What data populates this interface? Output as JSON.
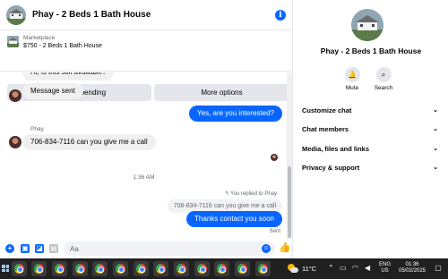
{
  "header": {
    "title": "Phay - 2 Beds 1 Bath House"
  },
  "marketplace": {
    "label": "Marketplace",
    "listing": "$750 - 2 Beds 1 Bath House",
    "pending_button": "Mark as pending",
    "more_button": "More options"
  },
  "messages": {
    "partial_top": "Hi, is this still available?",
    "msg1": "Message sent",
    "out1": "Yes, are you interested?",
    "sender": "Phay",
    "msg2": "706-834-7116 can you give me a call",
    "timestamp": "1:36 AM",
    "reply_note": "You replied to Phay",
    "quoted": "706-834-7116 can you give me a call",
    "out2": "Thanks contact you soon",
    "status": "Sent"
  },
  "composer": {
    "placeholder": "Aa"
  },
  "side_panel": {
    "title": "Phay - 2 Beds 1 Bath House",
    "mute_label": "Mute",
    "search_label": "Search",
    "rows": [
      "Customize chat",
      "Chat members",
      "Media, files and links",
      "Privacy & support"
    ]
  },
  "taskbar": {
    "temperature": "11°C",
    "lang": "ENG",
    "region": "US",
    "time": "01:36",
    "date": "05/02/2025"
  },
  "colors": {
    "accent": "#0866ff",
    "incoming_bubble": "#f0f0f0",
    "taskbar": "#202020"
  }
}
